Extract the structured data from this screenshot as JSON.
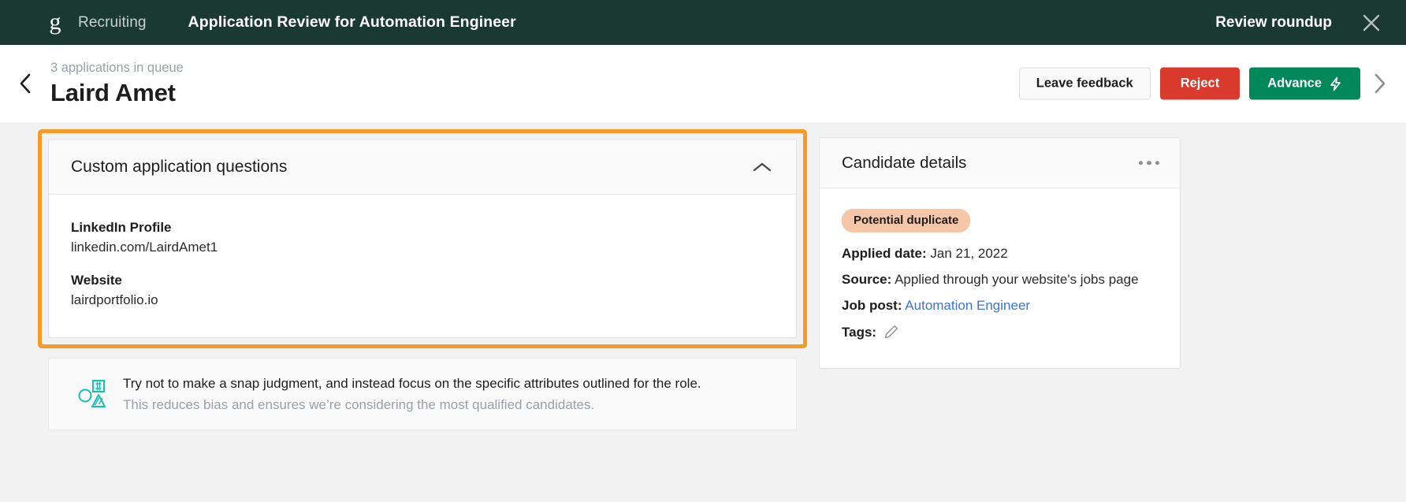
{
  "topbar": {
    "logo_glyph": "g",
    "logo_icon": "greenhouse-logo-icon",
    "brand": "Recruiting",
    "title": "Application Review for Automation Engineer",
    "roundup_label": "Review roundup",
    "close_icon": "close-icon"
  },
  "header": {
    "prev_icon": "chevron-left-icon",
    "next_icon": "chevron-right-icon",
    "queue_text": "3 applications in queue",
    "candidate_name": "Laird Amet",
    "actions": {
      "feedback": "Leave feedback",
      "reject": "Reject",
      "advance": "Advance",
      "advance_icon": "lightning-bolt-icon"
    }
  },
  "questions_card": {
    "title": "Custom application questions",
    "collapse_icon": "chevron-up-icon",
    "fields": [
      {
        "label": "LinkedIn Profile",
        "value": "linkedin.com/LairdAmet1"
      },
      {
        "label": "Website",
        "value": "lairdportfolio.io"
      }
    ]
  },
  "tip": {
    "icon": "shapes-icon",
    "line1": "Try not to make a snap judgment, and instead focus on the specific attributes outlined for the role.",
    "line2": "This reduces bias and ensures we’re considering the most qualified candidates."
  },
  "details_card": {
    "title": "Candidate details",
    "menu_icon": "more-options-icon",
    "badge": "Potential duplicate",
    "rows": [
      {
        "label": "Applied date:",
        "value": "Jan 21, 2022"
      },
      {
        "label": "Source:",
        "value": "Applied through your website's jobs page"
      },
      {
        "label": "Job post:",
        "value": "Automation Engineer",
        "link": true
      },
      {
        "label": "Tags:",
        "value": "",
        "edit_icon": "pencil-icon"
      }
    ]
  },
  "colors": {
    "topbar_bg": "#1a3a31",
    "highlight": "#f79a28",
    "reject": "#d93a2b",
    "advance": "#00875a",
    "badge_bg": "#f6c6a8",
    "link": "#3b74d6",
    "tip_icon": "#17bfb4"
  }
}
